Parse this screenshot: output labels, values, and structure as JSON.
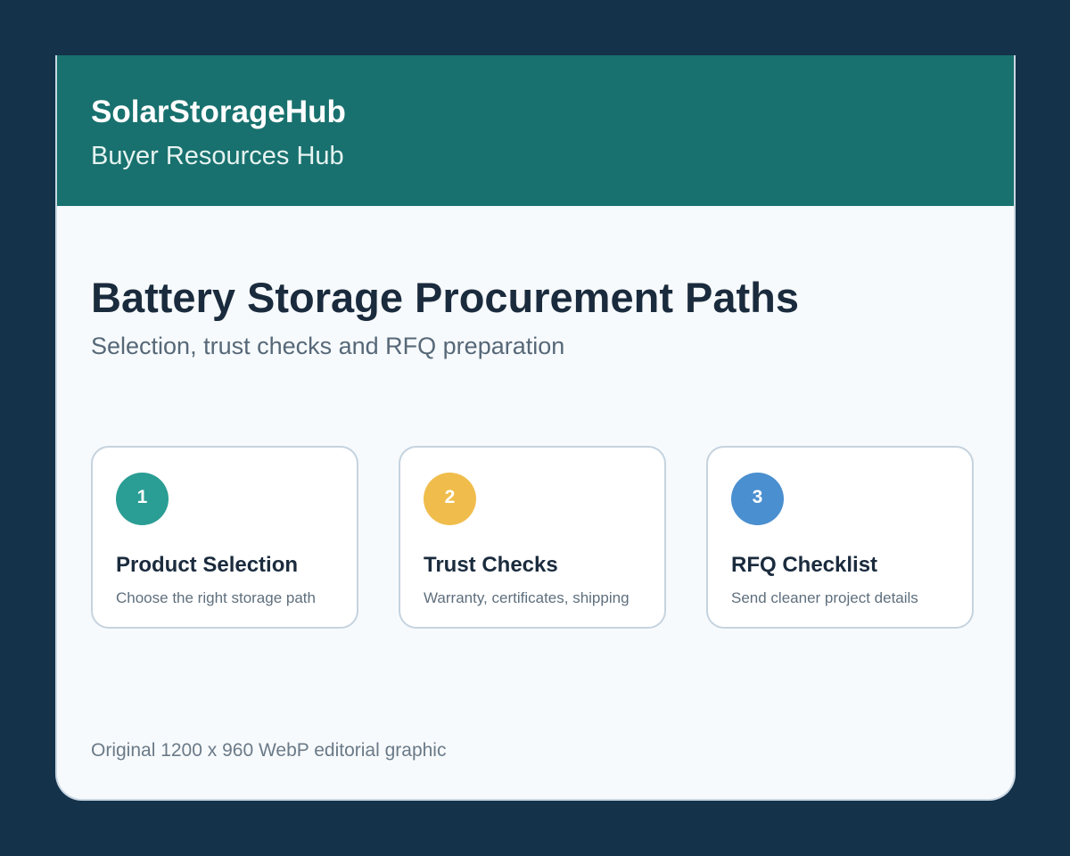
{
  "header": {
    "brand": "SolarStorageHub",
    "section": "Buyer Resources Hub",
    "background_color": "#18716e"
  },
  "main": {
    "title": "Battery Storage Procurement Paths",
    "subtitle": "Selection, trust checks and RFQ preparation"
  },
  "steps": [
    {
      "number": "1",
      "title": "Product Selection",
      "description": "Choose the right storage path",
      "color": "#2a9d94"
    },
    {
      "number": "2",
      "title": "Trust Checks",
      "description": "Warranty, certificates, shipping",
      "color": "#f0bd4c"
    },
    {
      "number": "3",
      "title": "RFQ Checklist",
      "description": "Send cleaner project details",
      "color": "#4a8fd0"
    }
  ],
  "footer": {
    "caption": "Original 1200 x 960 WebP editorial graphic"
  },
  "colors": {
    "page_background": "#14324a",
    "card_background": "#f7fafc"
  }
}
